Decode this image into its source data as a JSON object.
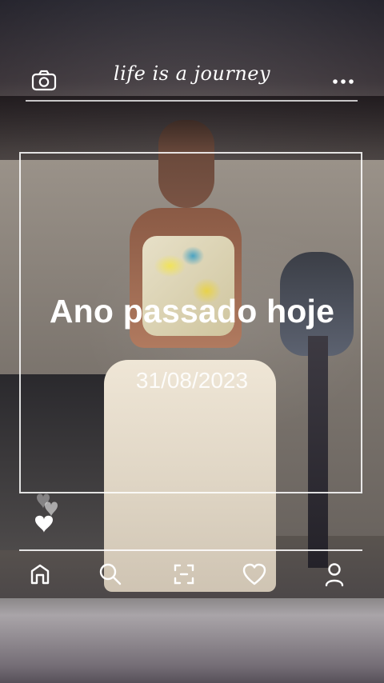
{
  "header": {
    "title": "life is a journey",
    "camera_icon": "camera-icon",
    "more_icon": "more-horizontal-icon"
  },
  "overlay": {
    "headline": "Ano passado hoje",
    "date": "31/08/2023"
  },
  "bottom_nav": {
    "items": [
      {
        "icon": "home-icon"
      },
      {
        "icon": "search-icon"
      },
      {
        "icon": "scan-icon"
      },
      {
        "icon": "heart-icon"
      },
      {
        "icon": "profile-icon"
      }
    ]
  },
  "reaction_icons": [
    "heart-icon",
    "heart-icon",
    "heart-icon"
  ]
}
